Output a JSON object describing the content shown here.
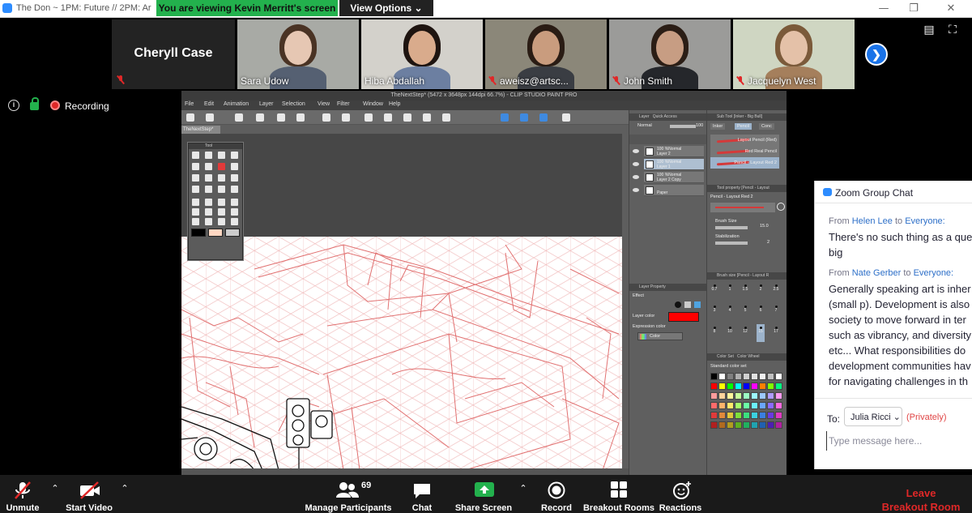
{
  "window": {
    "title": "The Don ~ 1PM: Future  // 2PM: Ar",
    "viewing_banner": "You are viewing Kevin Merritt's screen",
    "view_options": "View Options ⌄",
    "controls": {
      "minimize": "—",
      "restore": "❐",
      "close": "✕"
    }
  },
  "participants": {
    "named_tile": "Cheryll Case",
    "tiles": [
      {
        "name": "Sara Udow",
        "muted": false,
        "active": false,
        "bg": "#a8aaa5",
        "skin": "#e6c7b3",
        "hair": "#4a3324",
        "shirt": "#556072"
      },
      {
        "name": "Hiba Abdallah",
        "muted": false,
        "active": true,
        "bg": "#d3d1cb",
        "skin": "#d9ab8c",
        "hair": "#1e1410",
        "shirt": "#6c7fa1"
      },
      {
        "name": "aweisz@artsc...",
        "muted": true,
        "active": false,
        "bg": "#8b8779",
        "skin": "#c99c7e",
        "hair": "#2a1c14",
        "shirt": "#3a3d43"
      },
      {
        "name": "John Smith",
        "muted": true,
        "active": false,
        "bg": "#9b9b99",
        "skin": "#c79d83",
        "hair": "#2b1e16",
        "shirt": "#25272b"
      },
      {
        "name": "Jacquelyn West",
        "muted": true,
        "active": false,
        "bg": "#cfd6c2",
        "skin": "#e4c1a8",
        "hair": "#7b5a3a",
        "shirt": "#a57f5c"
      }
    ],
    "next_page_icon": "chevron-right-icon"
  },
  "recording": {
    "label": "Recording"
  },
  "shared_screen": {
    "app_title": "TheNextStep* (5472 x 3648px 144dpi 66.7%) - CLIP STUDIO PAINT PRO",
    "menu": [
      "File",
      "Edit",
      "Animation",
      "Layer",
      "Selection",
      "View",
      "Filter",
      "Window",
      "Help"
    ],
    "doc_tab": "TheNextStep*",
    "tool_palette_title": "Tool",
    "layer_panel": {
      "tab": "Layer",
      "tab2": "Quick Access",
      "blend": "Normal",
      "opacity": "100",
      "layers": [
        {
          "line1": "100 %Normal",
          "line2": "Layer 2"
        },
        {
          "line1": "100 %Normal",
          "line2": "Layer 1"
        },
        {
          "line1": "100 %Normal",
          "line2": "Layer 2 Copy"
        },
        {
          "line1": "",
          "line2": "Paper"
        }
      ]
    },
    "sub_tool": {
      "title": "Sub Tool [Inker - Big Bull]",
      "tabs": [
        "Inker",
        "Pencil",
        "Conc"
      ],
      "brushes": [
        "Layout Pencil (Red)",
        "Red Real Pencil",
        "Pencil - Layout Red 2"
      ]
    },
    "tool_property": {
      "title": "Tool property [Pencil - Layout",
      "brush_name": "Pencil - Layout Red 2",
      "brush_size_label": "Brush Size",
      "brush_size": "15.0",
      "stabilization_label": "Stabilization",
      "stabilization": "2"
    },
    "brush_size_panel": {
      "title": "Brush size [Pencil - Layout R",
      "sizes": [
        "0.7",
        "1",
        "1.5",
        "2",
        "2.5",
        "3",
        "4",
        "5",
        "6",
        "7",
        "8",
        "10",
        "12",
        "15",
        "17"
      ]
    },
    "layer_property": {
      "title": "Layer Property",
      "effect": "Effect",
      "layer_color": "Layer color",
      "expression_color": "Expression color",
      "color_mode": "Color"
    },
    "color_set": {
      "tab": "Color Set",
      "tab2": "Color Wheel",
      "set_name": "Standard color set",
      "colors": [
        "#000000",
        "#ffffff",
        "#808080",
        "#b0b0b0",
        "#d0d0d0",
        "#e0e0e0",
        "#f0f0f0",
        "#c0c0c0",
        "#ffffff",
        "#ff0000",
        "#ffff00",
        "#00ff00",
        "#00ffff",
        "#0000ff",
        "#ff00ff",
        "#ff8000",
        "#80ff00",
        "#00ff80",
        "#ff9c9c",
        "#ffd39c",
        "#fff59c",
        "#c8ff9c",
        "#9cffc4",
        "#9cf7ff",
        "#9cc8ff",
        "#b09cff",
        "#ff9cf0",
        "#ff6b6b",
        "#ffb46b",
        "#ffe96b",
        "#a6ff6b",
        "#6bffa6",
        "#6bf0ff",
        "#6ba6ff",
        "#8c6bff",
        "#ff6be0",
        "#e03b3b",
        "#e08a3b",
        "#e0c73b",
        "#7fe03b",
        "#3be07f",
        "#3bd0e0",
        "#3b7fe0",
        "#6a3be0",
        "#e03bc3",
        "#b02020",
        "#b06a20",
        "#b09d20",
        "#5fb020",
        "#20b05f",
        "#20a2b0",
        "#2060b0",
        "#4d20b0",
        "#b020a0"
      ]
    },
    "accent_color": "#ff0000"
  },
  "chat": {
    "title": "Zoom Group Chat",
    "messages": [
      {
        "from_label": "From",
        "sender": "Helen Lee",
        "to_label": "to",
        "recipient": "Everyone:",
        "lines": [
          "There's no such thing as a que",
          "big"
        ]
      },
      {
        "from_label": "From",
        "sender": "Nate Gerber",
        "to_label": "to",
        "recipient": "Everyone:",
        "lines": [
          "Generally speaking art is inher",
          "(small p). Development is also",
          "society to move forward in ter",
          "such as vibrancy, and diversity",
          "etc... What responsibilities do",
          "development communities hav",
          "for navigating challenges in th"
        ]
      }
    ],
    "to_label": "To:",
    "recipient_selected": "Julia Ricci ⌄",
    "privately": "(Privately)",
    "input_placeholder": "Type message here..."
  },
  "toolbar": {
    "unmute": "Unmute",
    "start_video": "Start Video",
    "participant_count": "69",
    "manage_participants": "Manage Participants",
    "chat": "Chat",
    "share_screen": "Share Screen",
    "record": "Record",
    "breakout_rooms": "Breakout Rooms",
    "reactions": "Reactions",
    "leave_line1": "Leave",
    "leave_line2": "Breakout Room"
  }
}
